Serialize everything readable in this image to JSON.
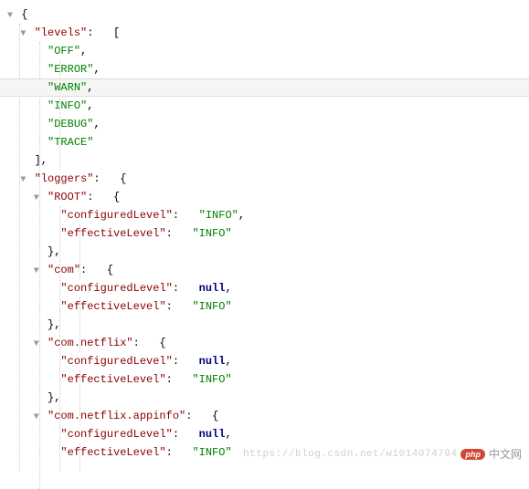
{
  "json": {
    "levels_key": "levels",
    "levels": [
      "OFF",
      "ERROR",
      "WARN",
      "INFO",
      "DEBUG",
      "TRACE"
    ],
    "loggers_key": "loggers",
    "loggers": [
      {
        "name": "ROOT",
        "configuredLevelKey": "configuredLevel",
        "configuredLevel": "\"INFO\"",
        "configuredIsNull": false,
        "effectiveLevelKey": "effectiveLevel",
        "effectiveLevel": "INFO"
      },
      {
        "name": "com",
        "configuredLevelKey": "configuredLevel",
        "configuredLevel": "null",
        "configuredIsNull": true,
        "effectiveLevelKey": "effectiveLevel",
        "effectiveLevel": "INFO"
      },
      {
        "name": "com.netflix",
        "configuredLevelKey": "configuredLevel",
        "configuredLevel": "null",
        "configuredIsNull": true,
        "effectiveLevelKey": "effectiveLevel",
        "effectiveLevel": "INFO"
      },
      {
        "name": "com.netflix.appinfo",
        "configuredLevelKey": "configuredLevel",
        "configuredLevel": "null",
        "configuredIsNull": true,
        "effectiveLevelKey": "effectiveLevel",
        "effectiveLevel": "INFO"
      }
    ]
  },
  "watermark": {
    "url": "https://blog.csdn.net/w1014074794",
    "badge": "php",
    "zh": "中文网"
  }
}
